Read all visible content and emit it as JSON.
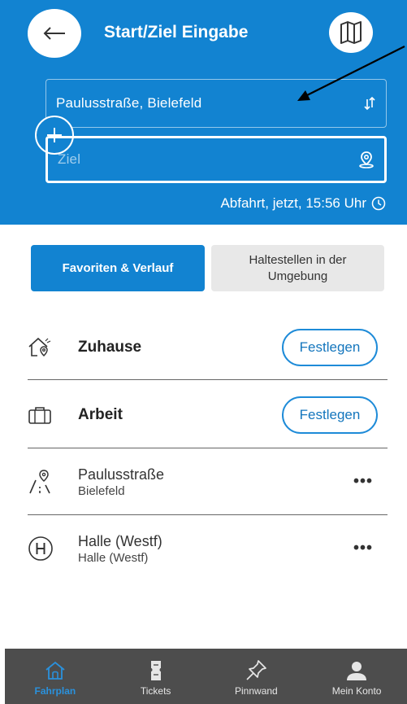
{
  "header": {
    "title": "Start/Ziel Eingabe",
    "start_value": "Paulusstraße, Bielefeld",
    "destination_placeholder": "Ziel",
    "departure_text": "Abfahrt, jetzt, 15:56 Uhr",
    "back_icon": "arrow-left-icon",
    "map_icon": "map-icon",
    "swap_icon": "swap-icon",
    "add_icon": "plus-icon",
    "location_icon": "location-pin-icon",
    "clock_icon": "clock-icon"
  },
  "tabs": {
    "favorites": "Favoriten & Verlauf",
    "nearby": "Haltestellen in der Umgebung"
  },
  "list": {
    "home": {
      "label": "Zuhause",
      "button": "Festlegen"
    },
    "work": {
      "label": "Arbeit",
      "button": "Festlegen"
    },
    "stop1": {
      "name": "Paulusstraße",
      "city": "Bielefeld",
      "more": "•••"
    },
    "stop2": {
      "name": "Halle (Westf)",
      "city": "Halle (Westf)",
      "more": "•••"
    }
  },
  "bottom_nav": {
    "items": [
      {
        "label": "Fahrplan",
        "icon": "home-icon",
        "active": true
      },
      {
        "label": "Tickets",
        "icon": "ticket-icon",
        "active": false
      },
      {
        "label": "Pinnwand",
        "icon": "pin-icon",
        "active": false
      },
      {
        "label": "Mein Konto",
        "icon": "user-icon",
        "active": false
      }
    ]
  },
  "colors": {
    "primary": "#1283d1",
    "nav_background": "#4d4d4d",
    "nav_active": "#2a91dc",
    "tab_inactive": "#e8e8e8"
  }
}
